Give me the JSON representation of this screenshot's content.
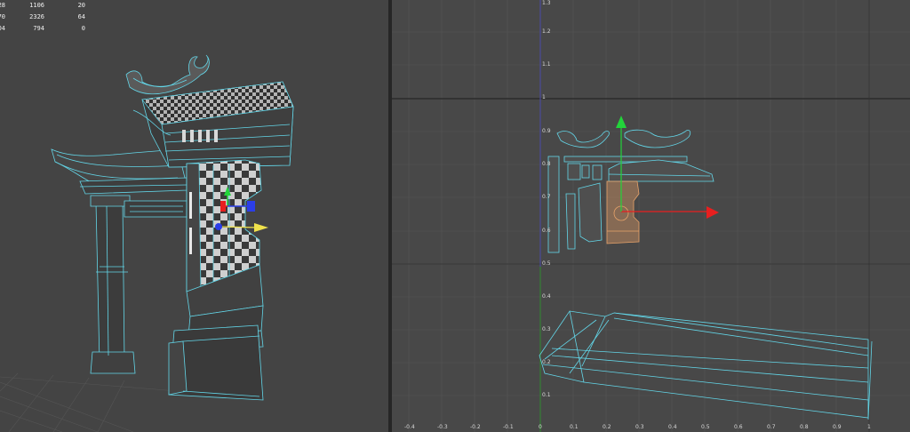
{
  "scene_stats": {
    "rows": [
      [
        "28",
        "1106",
        "20"
      ],
      [
        "70",
        "2326",
        "64"
      ],
      [
        "04",
        "794",
        "0"
      ]
    ]
  },
  "uv_editor": {
    "v_axis_labels": [
      "1.3",
      "1.2",
      "1.1",
      "1",
      "0.9",
      "0.8",
      "0.7",
      "0.6",
      "0.5",
      "0.4",
      "0.3",
      "0.2",
      "0.1"
    ],
    "u_axis_labels": [
      "-0.4",
      "-0.3",
      "-0.2",
      "-0.1",
      "0",
      "0.1",
      "0.2",
      "0.3",
      "0.4",
      "0.5",
      "0.6",
      "0.7",
      "0.8",
      "0.9",
      "1"
    ]
  },
  "colors": {
    "wireframe": "#63d6e8",
    "uv_selected": "#e8a36a",
    "manip_x": "#e81f1f",
    "manip_y": "#22d43a",
    "manip_z": "#2b3ee8",
    "manip_center": "#f0e24c",
    "grid_line": "#555555",
    "uv_axis_y": "#4a4aa8",
    "uv_axis_x": "#8a2a2a"
  },
  "icons": [
    "translate-manipulator-icon",
    "uv-move-manipulator-icon"
  ]
}
